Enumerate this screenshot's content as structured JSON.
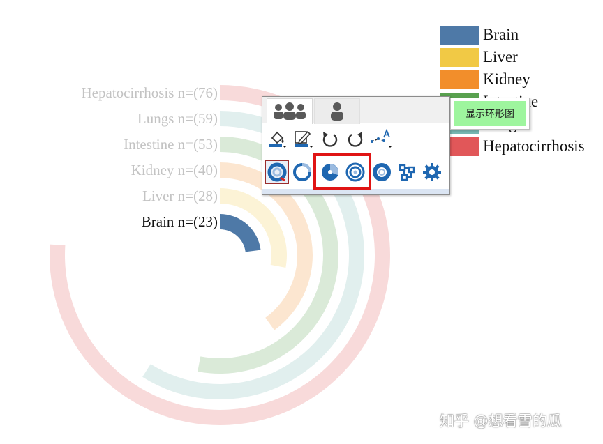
{
  "chart_data": {
    "type": "radial_bar",
    "series": [
      {
        "label": "Brain n=(23)",
        "category": "Brain",
        "value": 23,
        "color": "#4e79a7",
        "faded": false
      },
      {
        "label": "Liver n=(28)",
        "category": "Liver",
        "value": 28,
        "color": "#f1c945",
        "faded": true
      },
      {
        "label": "Kidney n=(40)",
        "category": "Kidney",
        "value": 40,
        "color": "#f28e2b",
        "faded": true
      },
      {
        "label": "Intestine n=(53)",
        "category": "Intestine",
        "value": 53,
        "color": "#59a14f",
        "faded": true
      },
      {
        "label": "Lungs n=(59)",
        "category": "Lungs",
        "value": 59,
        "color": "#76b7b2",
        "faded": true
      },
      {
        "label": "Hepatocirrhosis n=(76)",
        "category": "Hepatocirrhosis",
        "value": 76,
        "color": "#e15759",
        "faded": true
      }
    ],
    "max": 100,
    "legend_position": "top-right"
  },
  "legend": [
    {
      "label": "Brain",
      "color": "#4e79a7"
    },
    {
      "label": "Liver",
      "color": "#f1c945"
    },
    {
      "label": "Kidney",
      "color": "#f28e2b"
    },
    {
      "label": "Intestine",
      "color": "#59a14f"
    },
    {
      "label": "Lungs",
      "color": "#76b7b2"
    },
    {
      "label": "Hepatocirrhosis",
      "color": "#e15759"
    }
  ],
  "toolbar": {
    "tabs": [
      {
        "icon": "group-icon",
        "active": true
      },
      {
        "icon": "person-icon",
        "active": false
      }
    ],
    "row1": [
      "fill-color-icon",
      "stroke-color-icon",
      "rotate-left-icon",
      "rotate-right-icon",
      "label-style-icon"
    ],
    "row2": [
      "radial-bar-icon",
      "ring-icon",
      "pie-icon",
      "concentric-ring-icon",
      "donut-icon",
      "layout-icon",
      "settings-icon"
    ],
    "selected": "radial-bar-icon",
    "accent": "#1f67b1"
  },
  "tooltip": {
    "text": "显示环形图"
  },
  "watermark": {
    "text": "知乎 @想看雪的瓜"
  }
}
